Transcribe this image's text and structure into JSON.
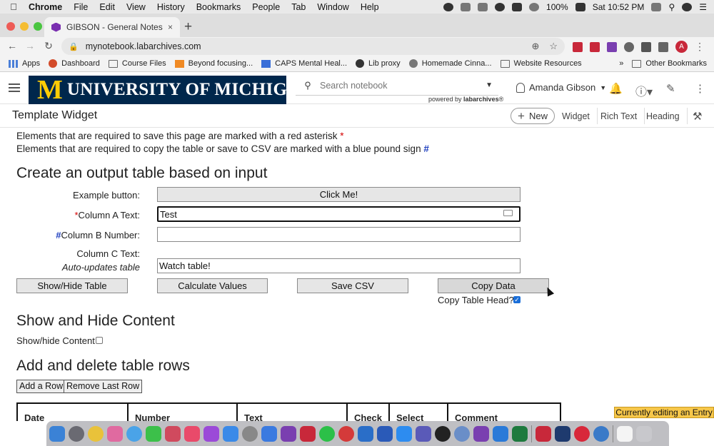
{
  "menubar": {
    "app": "Chrome",
    "items": [
      "File",
      "Edit",
      "View",
      "History",
      "Bookmarks",
      "People",
      "Tab",
      "Window",
      "Help"
    ],
    "battery": "100%",
    "clock": "Sat 10:52 PM"
  },
  "browser": {
    "tab_title": "GIBSON - General Notes - Lab",
    "tab_close": "×",
    "new_tab": "+",
    "url": "mynotebook.labarchives.com",
    "profile_initial": "A",
    "bookmarks": [
      "Apps",
      "Dashboard",
      "Course Files",
      "Beyond focusing...",
      "CAPS Mental Heal...",
      "Lib proxy",
      "Homemade Cinna...",
      "Website Resources"
    ],
    "bookmarks_more": "»",
    "other_bookmarks": "Other Bookmarks"
  },
  "labheader": {
    "logo_letter": "M",
    "logo_text": "UNIVERSITY OF MICHIGAN",
    "search_placeholder": "Search notebook",
    "powered_by": "powered by",
    "powered_brand": "labarchives",
    "user_name": "Amanda Gibson"
  },
  "pagebar": {
    "title": "Template Widget",
    "new_label": "New",
    "links": [
      "Widget",
      "Rich Text",
      "Heading"
    ]
  },
  "content": {
    "note_red_text": "Elements that are required to save this page are marked with a red asterisk ",
    "note_red_mark": "*",
    "note_blue_text": "Elements that are required to copy the table or save to CSV are marked with a blue pound sign ",
    "note_blue_mark": "#",
    "section1_title": "Create an output table based on input",
    "example_label": "Example button:",
    "example_button": "Click Me!",
    "colA_mark": "*",
    "colA_label": "Column A Text:",
    "colA_value": "Test",
    "colB_mark": "#",
    "colB_label": "Column B Number:",
    "colB_value": "",
    "colC_label": "Column C Text:",
    "colC_sublabel": "Auto-updates table",
    "colC_value": "Watch table!",
    "btn_show_hide": "Show/Hide Table",
    "btn_calculate": "Calculate Values",
    "btn_save_csv": "Save CSV",
    "btn_copy": "Copy Data",
    "copy_head_label": "Copy Table Head?",
    "copy_head_checked": true,
    "section2_title": "Show and Hide Content",
    "show_hide_label": "Show/hide Content",
    "show_hide_checked": false,
    "section3_title": "Add and delete table rows",
    "btn_add_row": "Add a Row",
    "btn_remove_row": "Remove Last Row",
    "table_headers": [
      "Date",
      "Number",
      "Text",
      "Check",
      "Select",
      "Comment"
    ]
  },
  "status_badge": "Currently editing an Entry",
  "colors": {
    "um_blue": "#00274c",
    "um_maize": "#ffcb05",
    "required_red": "#d40000",
    "required_blue": "#1f3fbf",
    "editing_badge": "#f7c74a"
  }
}
